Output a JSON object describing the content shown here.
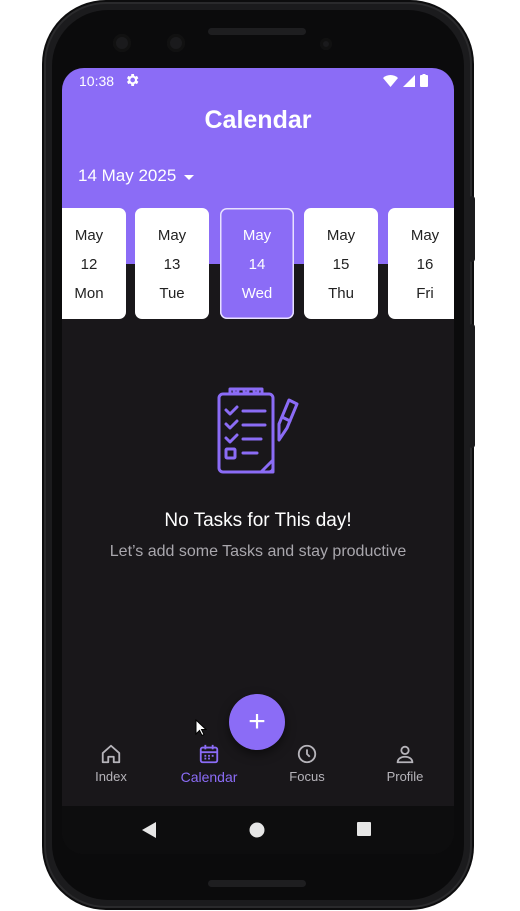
{
  "status_bar": {
    "time": "10:38",
    "settings_icon": "gear-icon",
    "wifi_icon": "wifi-icon",
    "signal_icon": "signal-icon",
    "battery_icon": "battery-icon"
  },
  "header": {
    "title": "Calendar",
    "selected_date": "14 May 2025",
    "dropdown_icon": "caret-down-icon"
  },
  "days": [
    {
      "month": "May",
      "day": "12",
      "weekday": "Mon",
      "selected": false
    },
    {
      "month": "May",
      "day": "13",
      "weekday": "Tue",
      "selected": false
    },
    {
      "month": "May",
      "day": "14",
      "weekday": "Wed",
      "selected": true
    },
    {
      "month": "May",
      "day": "15",
      "weekday": "Thu",
      "selected": false
    },
    {
      "month": "May",
      "day": "16",
      "weekday": "Fri",
      "selected": false
    }
  ],
  "empty_state": {
    "icon": "clipboard-checklist-icon",
    "title": "No Tasks for This day!",
    "subtitle": "Let’s add some Tasks and stay productive"
  },
  "fab": {
    "label": "+",
    "icon": "plus-icon"
  },
  "bottom_nav": [
    {
      "label": "Index",
      "icon": "home-icon",
      "active": false
    },
    {
      "label": "Calendar",
      "icon": "calendar-icon",
      "active": true
    },
    {
      "label": "Focus",
      "icon": "clock-icon",
      "active": false
    },
    {
      "label": "Profile",
      "icon": "person-icon",
      "active": false
    }
  ],
  "system_nav": {
    "back_icon": "back-triangle-icon",
    "home_icon": "home-circle-icon",
    "recents_icon": "recents-square-icon"
  },
  "colors": {
    "accent": "#8b6cf6",
    "background": "#19171a",
    "card": "#ffffff",
    "muted_text": "#a9a7ad"
  }
}
